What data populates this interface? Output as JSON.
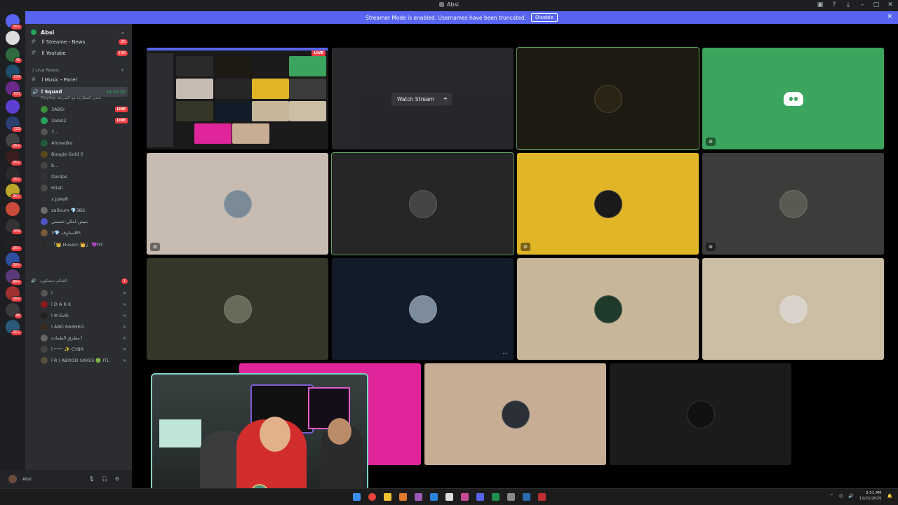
{
  "window": {
    "title": "Absi"
  },
  "banner": {
    "text": "Streamer Mode is enabled. Usernames have been truncated.",
    "button": "Disable"
  },
  "server": {
    "name": "Absi"
  },
  "channels": [
    {
      "name": "ll Streame・News",
      "count": "26"
    },
    {
      "name": "ll Youtube",
      "count": "168"
    }
  ],
  "live_room_category": "| Live Room",
  "music_channel": "l Music・Panel",
  "voice_channel": {
    "name": "l Squad",
    "time": "18:06:29",
    "playing": "Playing: تحدي المطاردة مع الشرطة"
  },
  "voice_users": [
    {
      "name": "3ABSI",
      "live": "LIVE",
      "color": "#3a8f3a"
    },
    {
      "name": "3absi2",
      "live": "LIVE",
      "color": "#23a55a"
    },
    {
      "name": "7...",
      "color": "#555"
    },
    {
      "name": "Ahmedko",
      "color": "#1f5d3a"
    },
    {
      "name": "Boogie Gold ll",
      "color": "#5b4a19"
    },
    {
      "name": "b...",
      "color": "#444"
    },
    {
      "name": "Dardas",
      "color": "#333"
    },
    {
      "name": "Hilali",
      "color": "#4a4a4a"
    },
    {
      "name": "x.JoKeR",
      "color": "#2f2f2f"
    },
    {
      "name": "zalloum 💎3BS",
      "color": "#6c6c6c"
    },
    {
      "name": "بنيش-امكي-خمسي",
      "color": "#4e54c8"
    },
    {
      "name": "سناوف 💎3BS",
      "color": "#7a5b3a"
    },
    {
      "name": "「👑 Husein 👑」 💜RT",
      "color": "#2a2a2a"
    }
  ],
  "voice_category": {
    "name": "القنائم ديسكورد",
    "count": "1"
  },
  "voice_category_users": [
    {
      "name": "l",
      "color": "#555"
    },
    {
      "name": "l D A R K",
      "color": "#8b1a1a"
    },
    {
      "name": "l ✉ Evik",
      "color": "#222"
    },
    {
      "name": "l ABO RASHED",
      "color": "#3b2b1e"
    },
    {
      "name": "مطرق الطماده l",
      "color": "#666"
    },
    {
      "name": "l ˢᵐᵃʳᵗ ✨ CYBR",
      "color": "#444"
    },
    {
      "name": "l R | ABOOD SAYES 🟢 ITL",
      "color": "#5a4e3a"
    }
  ],
  "user_panel": {
    "name": "Absi"
  },
  "stage": {
    "screenshare_live": "LIVE",
    "watch_button": "Watch Stream",
    "watch_icon": "+"
  },
  "tiles": [
    {
      "bg": "#1d1a12",
      "avatar": "#2b2415"
    },
    {
      "bg": "#3ba55d",
      "type": "discord"
    },
    {
      "bg": "#c8bcb2",
      "avatar": "#7a8a96"
    },
    {
      "bg": "#262626",
      "avatar": "#444"
    },
    {
      "bg": "#e0b527",
      "avatar": "#1a1a1a"
    },
    {
      "bg": "#3c3c3a",
      "avatar": "#5a5a52"
    },
    {
      "bg": "#353528",
      "avatar": "#6a6a5a"
    },
    {
      "bg": "#121c28",
      "avatar": "#7c8c9c"
    },
    {
      "bg": "#c8b699",
      "avatar": "#1f3a2a"
    },
    {
      "bg": "#cbbea5",
      "avatar": "#d9d3cb"
    },
    {
      "bg": "#e0259a",
      "type": "discord"
    },
    {
      "bg": "#c6ad93",
      "avatar": "#2b2f38"
    },
    {
      "bg": "#1b1b1b",
      "avatar": "#111"
    }
  ],
  "clock": {
    "time": "3:51 AM",
    "date": "11/21/2025"
  }
}
